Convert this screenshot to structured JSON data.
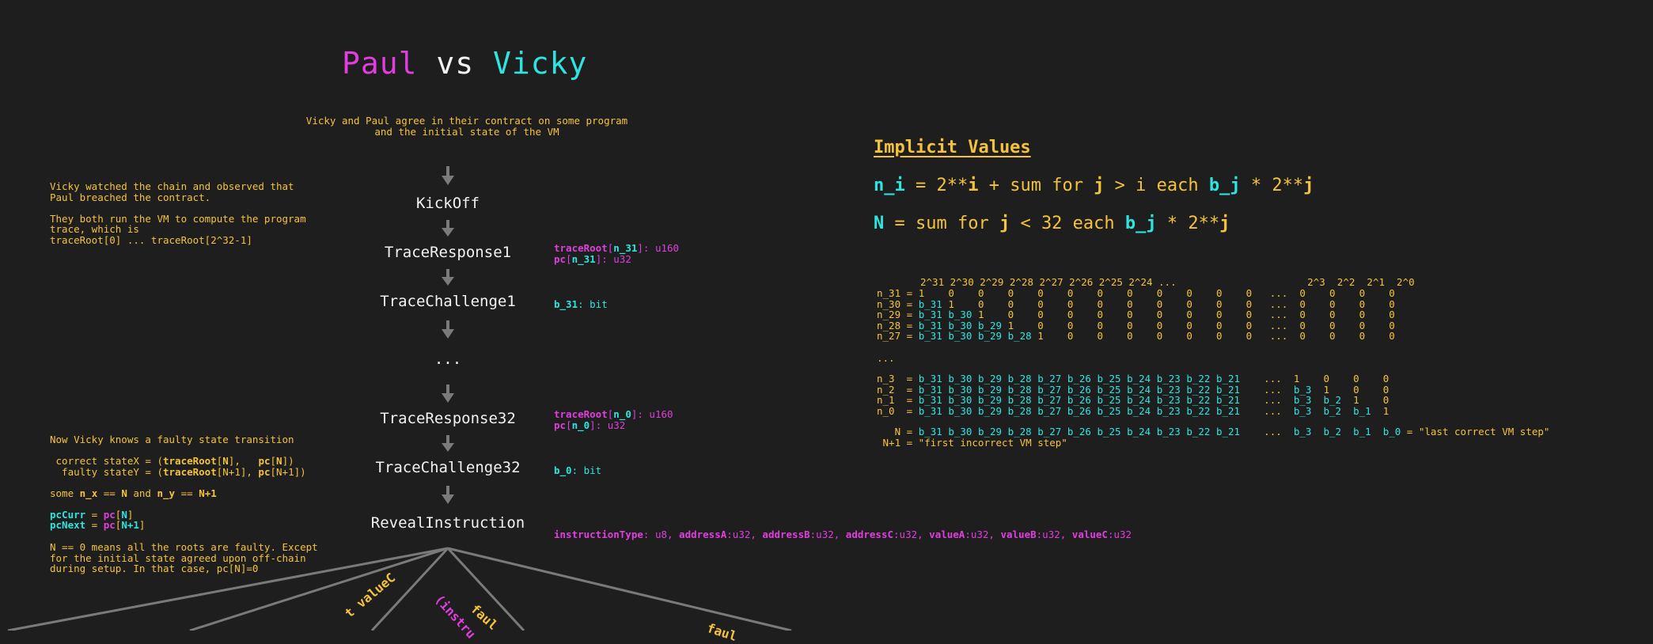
{
  "title": {
    "name1": "Paul",
    "vs": " vs ",
    "name2": "Vicky"
  },
  "intro": "Vicky and Paul agree in their contract on some program and the initial state of the VM",
  "steps": {
    "kickoff": "KickOff",
    "tr1": "TraceResponse1",
    "tc1": "TraceChallenge1",
    "dots": "...",
    "tr32": "TraceResponse32",
    "tc32": "TraceChallenge32",
    "reveal": "RevealInstruction"
  },
  "left_notes": {
    "watched": "Vicky watched the chain and observed that\nPaul breached the contract.\n\nThey both run the VM to compute the program\ntrace, which is\ntraceRoot[0] ... traceRoot[2^32-1]",
    "knows": "Now Vicky knows a faulty state transition",
    "correct_prefix": " correct stateX = (",
    "faulty_prefix": "  faulty stateY = (",
    "traceRoot": "traceRoot",
    "pc": "pc",
    "N": "N",
    "N1": "N+1",
    "some_prefix": "some ",
    "n_x": "n_x",
    "eq": " == ",
    "and": " and ",
    "n_y": "n_y",
    "pcCurr": "pcCurr",
    "pcNext": "pcNext",
    "final": "N == 0 means all the roots are faulty. Except\nfor the initial state agreed upon off-chain\nduring setup. In that case, pc[N]=0"
  },
  "annotations": {
    "tr1_a": "traceRoot",
    "tr1_b": "n_31",
    "tr1_c": ": u160",
    "tr1_d": "pc",
    "tr1_e": "n_31",
    "tr1_f": ": u32",
    "tc1_a": "b_31",
    "tc1_b": ": bit",
    "tr32_a": "traceRoot",
    "tr32_b": "n_0",
    "tr32_c": ": u160",
    "tr32_d": "pc",
    "tr32_e": "n_0",
    "tr32_f": ": u32",
    "tc32_a": "b_0",
    "tc32_b": ": bit",
    "reveal_fields": [
      {
        "name": "instructionType",
        "type": ": u8, "
      },
      {
        "name": "addressA",
        "type": ":u32, "
      },
      {
        "name": "addressB",
        "type": ":u32, "
      },
      {
        "name": "addressC",
        "type": ":u32, "
      },
      {
        "name": "valueA",
        "type": ":u32, "
      },
      {
        "name": "valueB",
        "type": ":u32, "
      },
      {
        "name": "valueC",
        "type": ":u32"
      }
    ]
  },
  "branch_labels": {
    "a": "t valueC",
    "b": "(instru",
    "c": "faul",
    "d": "faul"
  },
  "implicit": {
    "title": "Implicit Values",
    "f1": {
      "a": "n_i",
      "b": " = 2**",
      "c": "i",
      "d": " + sum for ",
      "e": "j",
      "f": " > i each ",
      "g": "b_j",
      "h": " * 2**",
      "i": "j"
    },
    "f2": {
      "a": "N",
      "b": " = sum for ",
      "c": "j",
      "d": " < 32 each ",
      "e": "b_j",
      "f": " * 2**",
      "g": "j"
    }
  },
  "table": {
    "header": "2^31 2^30 2^29 2^28 2^27 2^26 2^25 2^24 ...                      2^3  2^2  2^1  2^0",
    "rows_top": [
      {
        "label": "n_31 = ",
        "cyan": "",
        "rest": "1    0    0    0    0    0    0    0    0    0    0    0   ...  0    0    0    0"
      },
      {
        "label": "n_30 = ",
        "cyan": "b_31 ",
        "rest": "1    0    0    0    0    0    0    0    0    0    0   ...  0    0    0    0"
      },
      {
        "label": "n_29 = ",
        "cyan": "b_31 b_30 ",
        "rest": "1    0    0    0    0    0    0    0    0    0   ...  0    0    0    0"
      },
      {
        "label": "n_28 = ",
        "cyan": "b_31 b_30 b_29 ",
        "rest": "1    0    0    0    0    0    0    0    0   ...  0    0    0    0"
      },
      {
        "label": "n_27 = ",
        "cyan": "b_31 b_30 b_29 b_28 ",
        "rest": "1    0    0    0    0    0    0    0   ...  0    0    0    0"
      }
    ],
    "ellipsis": "...",
    "rows_bottom": [
      {
        "label": "n_3  = ",
        "cyan": "b_31 b_30 b_29 b_28 b_27 b_26 b_25 b_24 b_23 b_22 b_21",
        "mid": "    ...  ",
        "cyan2": "",
        "rest": "1    0    0    0"
      },
      {
        "label": "n_2  = ",
        "cyan": "b_31 b_30 b_29 b_28 b_27 b_26 b_25 b_24 b_23 b_22 b_21",
        "mid": "    ...  ",
        "cyan2": "b_3  ",
        "rest": "1    0    0"
      },
      {
        "label": "n_1  = ",
        "cyan": "b_31 b_30 b_29 b_28 b_27 b_26 b_25 b_24 b_23 b_22 b_21",
        "mid": "    ...  ",
        "cyan2": "b_3  b_2  ",
        "rest": "1    0"
      },
      {
        "label": "n_0  = ",
        "cyan": "b_31 b_30 b_29 b_28 b_27 b_26 b_25 b_24 b_23 b_22 b_21",
        "mid": "    ...  ",
        "cyan2": "b_3  b_2  b_1  ",
        "rest": "1"
      }
    ],
    "n_row": {
      "label": "   N = ",
      "cyan": "b_31 b_30 b_29 b_28 b_27 b_26 b_25 b_24 b_23 b_22 b_21",
      "mid": "    ...  ",
      "cyan2": "b_3  b_2  b_1  b_0",
      "rest": " = \"last correct VM step\""
    },
    "n1_row": " N+1 = \"first incorrect VM step\""
  },
  "colors": {
    "bg": "#1e1e1e",
    "yellow": "#f5c33b",
    "cyan": "#2ce5e0",
    "magenta": "#e23ddf",
    "white": "#f2f2f2",
    "arrow": "#7a7a7a"
  }
}
